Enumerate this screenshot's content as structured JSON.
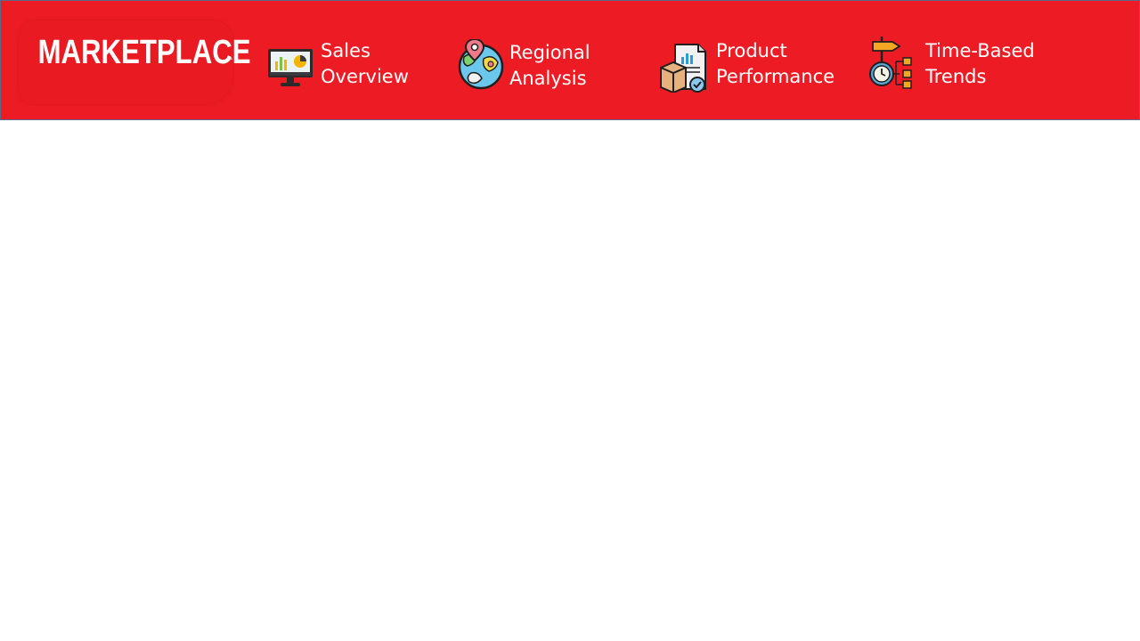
{
  "brand": {
    "logo_text": "MARKETPLACE",
    "trademark": "™"
  },
  "nav": {
    "items": [
      {
        "line1": "Sales",
        "line2": "Overview",
        "icon": "monitor-chart-icon"
      },
      {
        "line1": "Regional",
        "line2": "Analysis",
        "icon": "globe-location-icon"
      },
      {
        "line1": "Product",
        "line2": "Performance",
        "icon": "package-report-icon"
      },
      {
        "line1": "Time-Based",
        "line2": "Trends",
        "icon": "clock-flow-icon"
      }
    ]
  },
  "colors": {
    "header_bg": "#ed1c24",
    "text": "#ffffff",
    "page_bg": "#ffffff"
  }
}
